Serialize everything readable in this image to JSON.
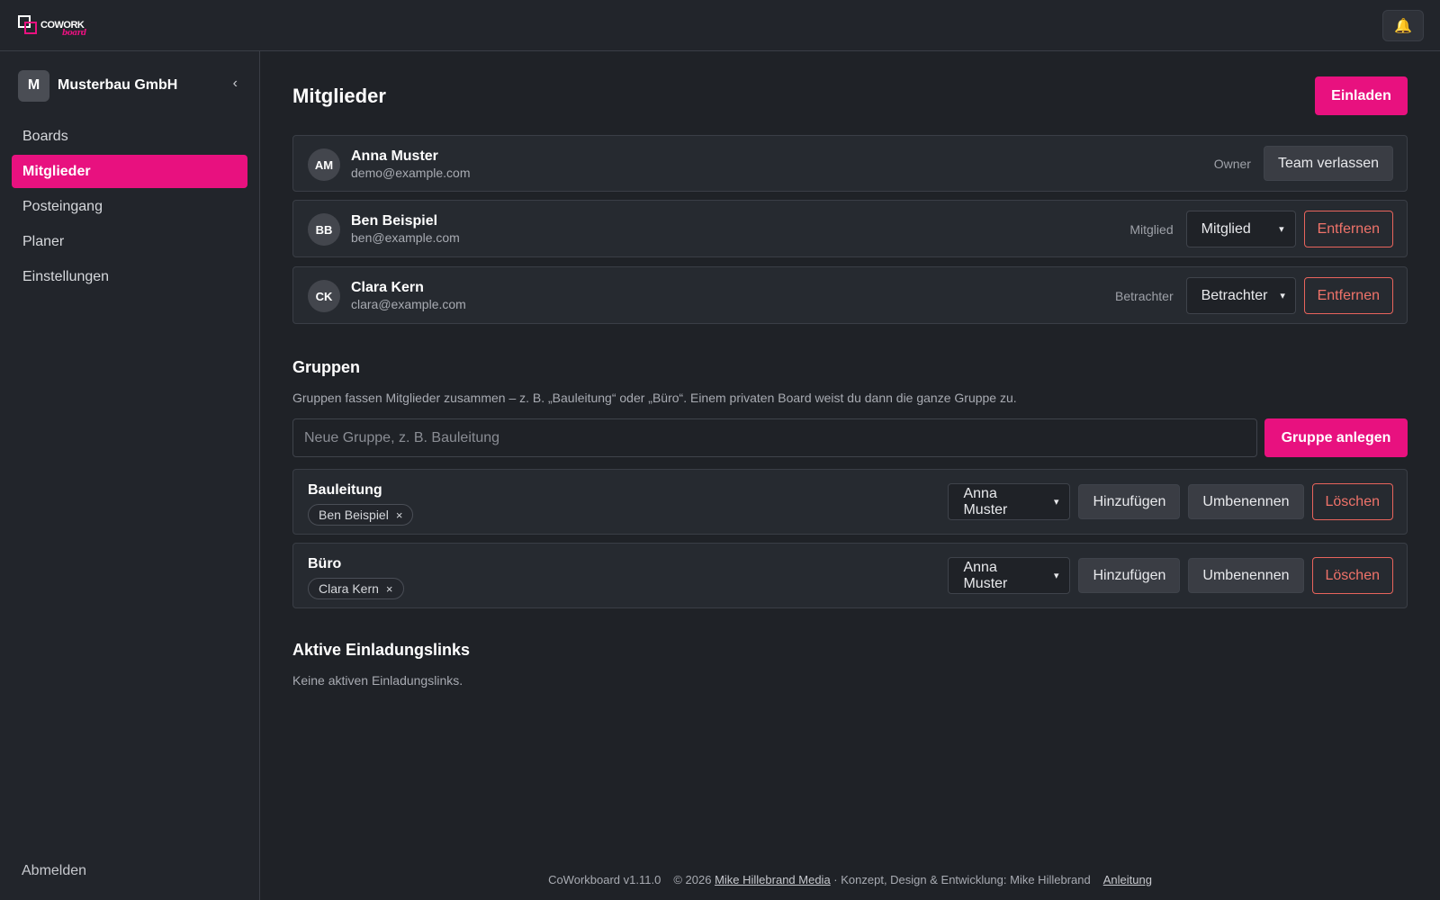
{
  "app": {
    "logo_text": "COWORK",
    "logo_sub": "board"
  },
  "sidebar": {
    "team_initial": "M",
    "team_name": "Musterbau GmbH",
    "collapse_glyph": "‹",
    "items": [
      {
        "label": "Boards"
      },
      {
        "label": "Mitglieder"
      },
      {
        "label": "Posteingang"
      },
      {
        "label": "Planer"
      },
      {
        "label": "Einstellungen"
      }
    ],
    "logout": "Abmelden"
  },
  "header": {
    "bell_glyph": "🔔"
  },
  "members": {
    "title": "Mitglieder",
    "invite_label": "Einladen",
    "list": [
      {
        "initials": "AM",
        "name": "Anna Muster",
        "email": "demo@example.com",
        "role": "Owner",
        "action": "Team verlassen"
      },
      {
        "initials": "BB",
        "name": "Ben Beispiel",
        "email": "ben@example.com",
        "role": "Mitglied",
        "select": "Mitglied",
        "action": "Entfernen"
      },
      {
        "initials": "CK",
        "name": "Clara Kern",
        "email": "clara@example.com",
        "role": "Betrachter",
        "select": "Betrachter",
        "action": "Entfernen"
      }
    ]
  },
  "groups": {
    "title": "Gruppen",
    "description": "Gruppen fassen Mitglieder zusammen – z. B. „Bauleitung“ oder „Büro“. Einem privaten Board weist du dann die ganze Gruppe zu.",
    "input_placeholder": "Neue Gruppe, z. B. Bauleitung",
    "create_label": "Gruppe anlegen",
    "add_label": "Hinzufügen",
    "rename_label": "Umbenennen",
    "delete_label": "Löschen",
    "chip_remove": "×",
    "list": [
      {
        "name": "Bauleitung",
        "member_chip": "Ben Beispiel",
        "select": "Anna Muster"
      },
      {
        "name": "Büro",
        "member_chip": "Clara Kern",
        "select": "Anna Muster"
      }
    ]
  },
  "invites": {
    "title": "Aktive Einladungslinks",
    "empty": "Keine aktiven Einladungslinks."
  },
  "footer": {
    "version": "CoWorkboard v1.11.0",
    "copyright_prefix": "© 2026 ",
    "company_link": "Mike Hillebrand Media",
    "credits": " · Konzept, Design & Entwicklung: Mike Hillebrand",
    "guide_link": "Anleitung"
  }
}
